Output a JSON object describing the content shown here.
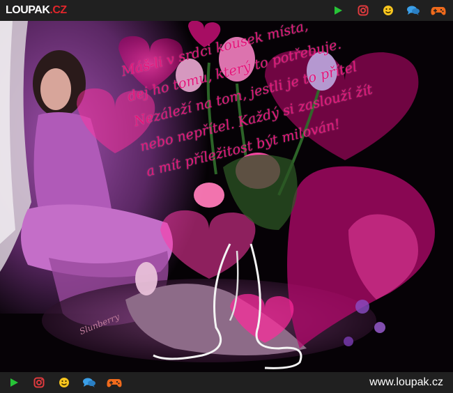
{
  "header": {
    "logo_main": "LOUPAK",
    "logo_suffix": ".CZ",
    "icons": [
      "play-icon",
      "instagram-icon",
      "smiley-icon",
      "chat-icon",
      "gamepad-icon"
    ]
  },
  "footer": {
    "url": "www.loupak.cz",
    "icons": [
      "play-icon",
      "instagram-icon",
      "smiley-icon",
      "chat-icon",
      "gamepad-icon"
    ]
  },
  "image": {
    "poem_lines": [
      "Máš-li v srdci kousek místa,",
      "dej ho tomu, který to potřebuje.",
      "Nezáleží na tom, jestli je to přítel",
      "nebo nepřítel. Každý si zaslouží žít",
      "a mít příležitost být milován!"
    ],
    "signature": "Slunberry"
  },
  "colors": {
    "bar": "#202020",
    "logo_accent": "#e0262b",
    "play": "#27c437",
    "instagram": "#e03a3e",
    "smiley": "#f7c51e",
    "chat": "#3b9fe8",
    "gamepad": "#f06a1c",
    "poem_text": "#e4157a"
  }
}
